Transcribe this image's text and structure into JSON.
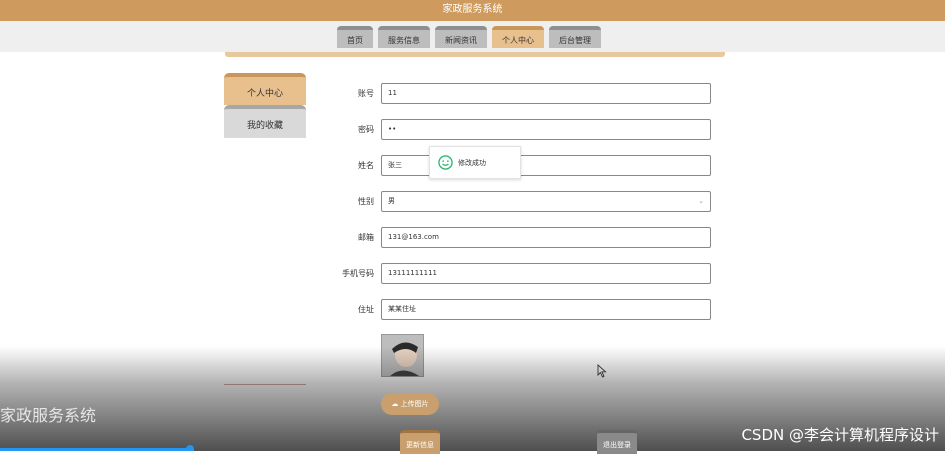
{
  "app": {
    "title": "家政服务系统"
  },
  "nav": {
    "tabs": [
      {
        "label": "首页"
      },
      {
        "label": "服务信息"
      },
      {
        "label": "新闻资讯"
      },
      {
        "label": "个人中心"
      },
      {
        "label": "后台管理"
      }
    ],
    "active": "个人中心"
  },
  "sidebar": {
    "items": [
      {
        "label": "个人中心"
      },
      {
        "label": "我的收藏"
      }
    ]
  },
  "form": {
    "account": {
      "label": "账号",
      "value": "11"
    },
    "password": {
      "label": "密码",
      "value": "••"
    },
    "name": {
      "label": "姓名",
      "value": "张三"
    },
    "gender": {
      "label": "性别",
      "value": "男"
    },
    "email": {
      "label": "邮箱",
      "value": "131@163.com"
    },
    "phone": {
      "label": "手机号码",
      "value": "13111111111"
    },
    "address": {
      "label": "住址",
      "value": "某某住址"
    },
    "upload_label": "上传图片",
    "update_label": "更新信息",
    "logout_label": "退出登录"
  },
  "toast": {
    "text": "修改成功",
    "icon": "smile-icon"
  },
  "video_overlay": {
    "title": "家政服务系统"
  },
  "watermark": "CSDN @李会计算机程序设计",
  "colors": {
    "accent": "#cf9a5d",
    "active_tab": "#e7c08e",
    "toast_icon": "#2bb673"
  }
}
